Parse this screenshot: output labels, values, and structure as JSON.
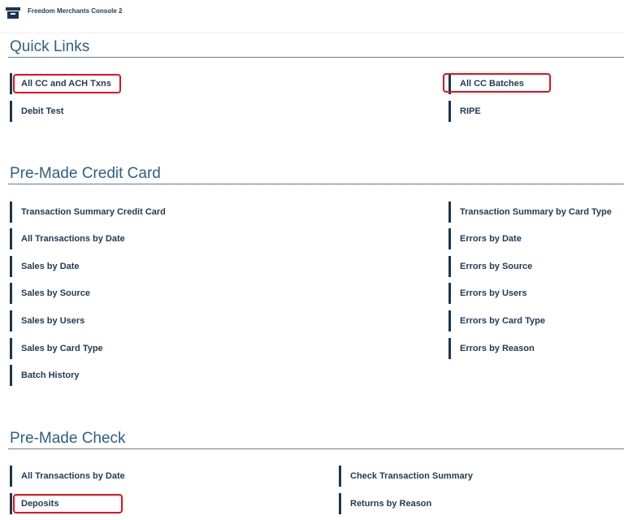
{
  "app": {
    "title": "Freedom Merchants Console 2",
    "logo_icon": "store-icon"
  },
  "accent_color": "#1b3654",
  "highlight_color": "#e0121e",
  "quick_links": {
    "title": "Quick Links",
    "items": [
      {
        "label": "All CC and ACH Txns",
        "highlighted": true
      },
      {
        "label": "All CC Batches",
        "highlighted": true
      },
      {
        "label": "Debit Test",
        "highlighted": false
      },
      {
        "label": "RIPE",
        "highlighted": false
      }
    ]
  },
  "credit_card": {
    "title": "Pre-Made Credit Card",
    "left": [
      "Transaction Summary Credit Card",
      "All Transactions by Date",
      "Sales by Date",
      "Sales by Source",
      "Sales by Users",
      "Sales by Card Type",
      "Batch History"
    ],
    "right": [
      "Transaction Summary by Card Type",
      "Errors by Date",
      "Errors by Source",
      "Errors by Users",
      "Errors by Card Type",
      "Errors by Reason"
    ]
  },
  "check": {
    "title": "Pre-Made Check",
    "items": [
      {
        "label": "All Transactions by Date",
        "highlighted": false
      },
      {
        "label": "Check Transaction Summary",
        "highlighted": false
      },
      {
        "label": "Deposits",
        "highlighted": true
      },
      {
        "label": "Returns by Reason",
        "highlighted": false
      }
    ]
  }
}
